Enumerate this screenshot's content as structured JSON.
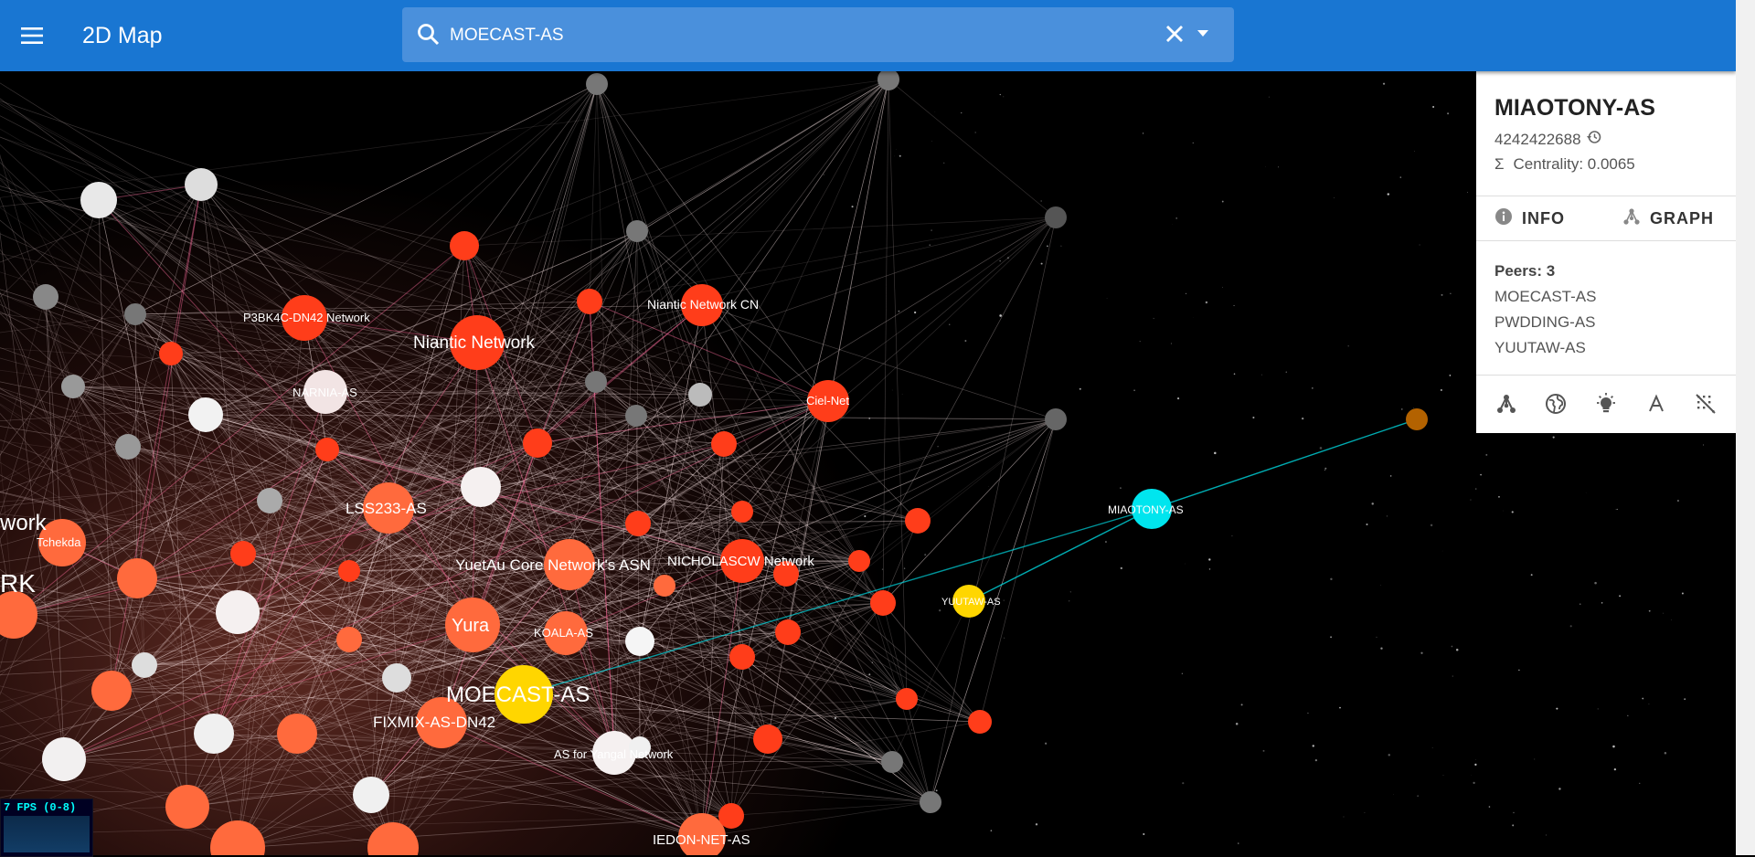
{
  "app": {
    "title": "2D Map"
  },
  "search": {
    "value": "MOECAST-AS"
  },
  "icons": [
    "menu-icon",
    "search-icon",
    "close-icon",
    "arrow-drop-down-icon",
    "history-icon",
    "sigma-icon",
    "info-icon",
    "graph-icon",
    "network-icon",
    "globe-icon",
    "lightbulb-icon",
    "text-icon",
    "grid-off-icon"
  ],
  "panel": {
    "name": "MIAOTONY-AS",
    "asn": "4242422688",
    "centrality": "Centrality: 0.0065",
    "tabs": [
      "INFO",
      "GRAPH"
    ],
    "peers_label": "Peers: 3",
    "peers": [
      "MOECAST-AS",
      "PWDDING-AS",
      "YUUTAW-AS"
    ]
  },
  "fps": "7 FPS (0-8)",
  "colors": {
    "appbar": "#1976d2",
    "selected": "#00e5ee",
    "highlight": "#ffd600",
    "node_red": "#ff3d1a",
    "node_orange": "#ff6a3d"
  },
  "map_labels": [
    "MIAOTONY-AS",
    "MOECAST-AS",
    "YUUTAW-AS",
    "Niantic Network",
    "Niantic Network CN",
    "Ciel-Net",
    "P3BK4C-DN42 Network",
    "NARNIA-AS",
    "LSS233-AS",
    "YuetAu Core Network's ASN",
    "NICHOLASCW Network",
    "Yura",
    "KOALA-AS",
    "FIXMIX-AS-DN42",
    "AS for Yangal Network",
    "IEDON-NET-AS",
    "Tchekda",
    "work",
    "RK"
  ]
}
